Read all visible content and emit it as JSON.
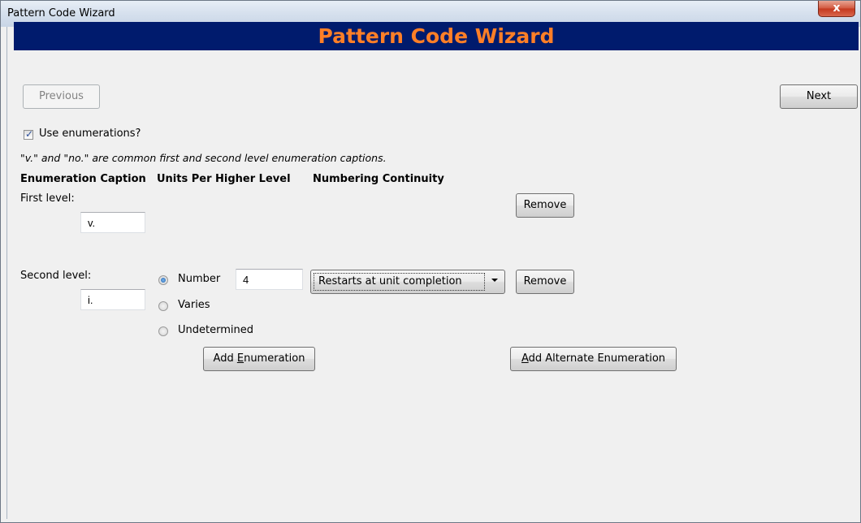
{
  "window": {
    "title": "Pattern Code Wizard",
    "close_label": "x"
  },
  "banner": {
    "title": "Pattern Code Wizard",
    "title_color": "#ff7f27",
    "background": "#001b6d"
  },
  "nav": {
    "previous_label": "Previous",
    "next_label": "Next"
  },
  "use_enumerations": {
    "label": "Use enumerations?",
    "checked": true
  },
  "hint": "\"v.\" and \"no.\" are common first and second level enumeration captions.",
  "headers": {
    "caption": "Enumeration Caption",
    "units": "Units Per Higher Level",
    "continuity": "Numbering Continuity"
  },
  "first_level": {
    "label": "First level:",
    "caption_value": "v.",
    "remove_label": "Remove"
  },
  "second_level": {
    "label": "Second level:",
    "caption_value": "i.",
    "units_options": [
      {
        "label": "Number",
        "selected": true
      },
      {
        "label": "Varies",
        "selected": false
      },
      {
        "label": "Undetermined",
        "selected": false
      }
    ],
    "number_value": "4",
    "continuity_selected": "Restarts at unit completion",
    "remove_label": "Remove"
  },
  "actions": {
    "add_enumeration_prefix": "Add ",
    "add_enumeration_accel": "E",
    "add_enumeration_rest": "numeration",
    "add_alternate_accel": "A",
    "add_alternate_rest": "dd Alternate Enumeration"
  }
}
